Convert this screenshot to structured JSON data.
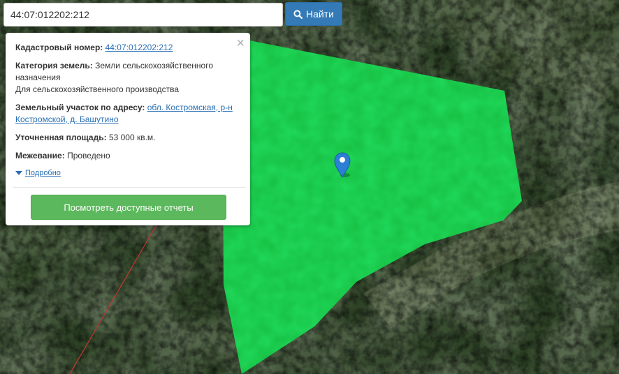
{
  "search": {
    "value": "44:07:012202:212",
    "button_label": "Найти"
  },
  "popup": {
    "cadastral": {
      "label": "Кадастровый номер:",
      "value": "44:07:012202:212"
    },
    "category": {
      "label": "Категория земель:",
      "value_first": "Земли сельскохозяйственного",
      "value_second": "назначения",
      "use": "Для сельскохозяйственного производства"
    },
    "address": {
      "label": "Земельный участок по адресу:",
      "value_first": "обл. Костромская, р-н",
      "value_second": "Костромской, д. Башутино"
    },
    "area": {
      "label": "Уточненная площадь:",
      "value": "53 000 кв.м."
    },
    "survey": {
      "label": "Межевание:",
      "value": "Проведено"
    },
    "details_label": "Подробно",
    "report_button": "Посмотреть доступные отчеты"
  },
  "colors": {
    "parcel": "#1fd85a",
    "search_button": "#337ab7",
    "report_button": "#5cb85c",
    "link": "#2a6fb5",
    "marker": "#2b7fd4"
  },
  "icons": {
    "search_button": "search-icon",
    "close": "close-icon",
    "details": "caret-down-icon",
    "marker": "map-marker-icon"
  }
}
